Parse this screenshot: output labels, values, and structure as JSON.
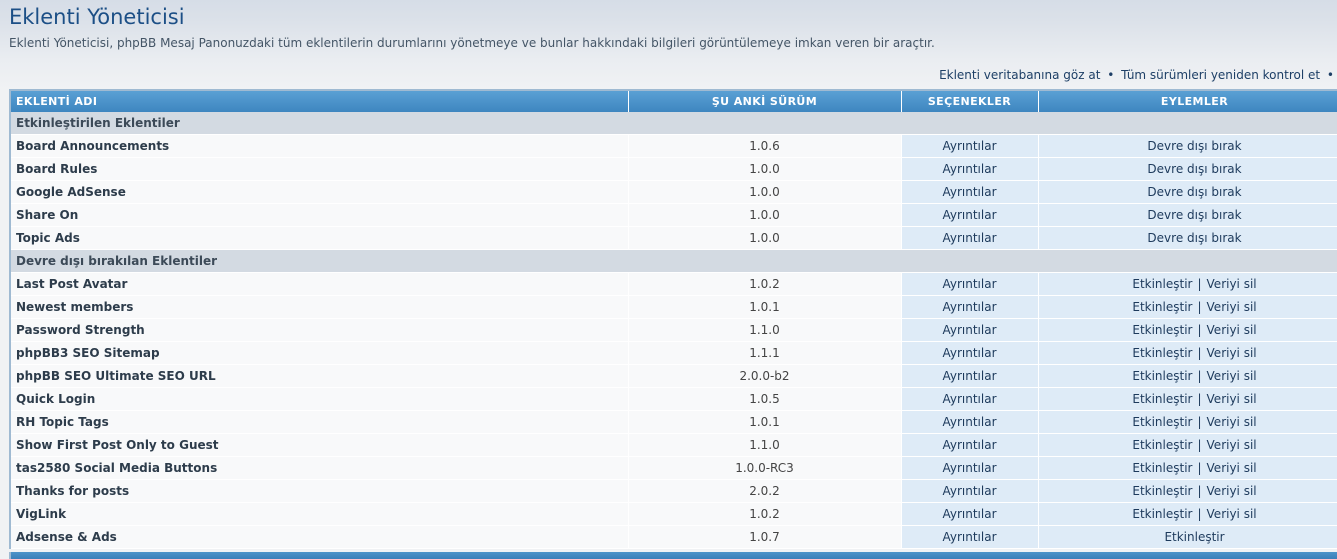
{
  "page": {
    "title": "Eklenti Yöneticisi",
    "description": "Eklenti Yöneticisi, phpBB Mesaj Panonuzdaki tüm eklentilerin durumlarını yönetmeye ve bunlar hakkındaki bilgileri görüntülemeye imkan veren bir araçtır."
  },
  "top_links": {
    "browse_db": "Eklenti veritabanına göz at",
    "recheck_all": "Tüm sürümleri yeniden kontrol et",
    "separator": "•"
  },
  "table": {
    "headers": {
      "name": "EKLENTİ ADI",
      "version": "ŞU ANKİ SÜRÜM",
      "options": "SEÇENEKLER",
      "actions": "EYLEMLER"
    },
    "labels": {
      "details": "Ayrıntılar",
      "disable": "Devre dışı bırak",
      "enable": "Etkinleştir",
      "delete_data": "Veriyi sil",
      "pipe": "|"
    },
    "sections": {
      "enabled": "Etkinleştirilen Eklentiler",
      "disabled": "Devre dışı bırakılan Eklentiler"
    },
    "enabled_rows": [
      {
        "name": "Board Announcements",
        "version": "1.0.6"
      },
      {
        "name": "Board Rules",
        "version": "1.0.0"
      },
      {
        "name": "Google AdSense",
        "version": "1.0.0"
      },
      {
        "name": "Share On",
        "version": "1.0.0"
      },
      {
        "name": "Topic Ads",
        "version": "1.0.0"
      }
    ],
    "disabled_rows": [
      {
        "name": "Last Post Avatar",
        "version": "1.0.2"
      },
      {
        "name": "Newest members",
        "version": "1.0.1"
      },
      {
        "name": "Password Strength",
        "version": "1.1.0"
      },
      {
        "name": "phpBB3 SEO Sitemap",
        "version": "1.1.1"
      },
      {
        "name": "phpBB SEO Ultimate SEO URL",
        "version": "2.0.0-b2"
      },
      {
        "name": "Quick Login",
        "version": "1.0.5"
      },
      {
        "name": "RH Topic Tags",
        "version": "1.0.1"
      },
      {
        "name": "Show First Post Only to Guest",
        "version": "1.1.0"
      },
      {
        "name": "tas2580 Social Media Buttons",
        "version": "1.0.0-RC3"
      },
      {
        "name": "Thanks for posts",
        "version": "2.0.2"
      },
      {
        "name": "VigLink",
        "version": "1.0.2"
      },
      {
        "name": "Adsense & Ads",
        "version": "1.0.7"
      }
    ]
  },
  "colors": {
    "header_blue": "#3e86c0",
    "title_blue": "#1c4f86",
    "section_gray": "#d3dae2",
    "cell_light_blue": "#deebf7"
  }
}
